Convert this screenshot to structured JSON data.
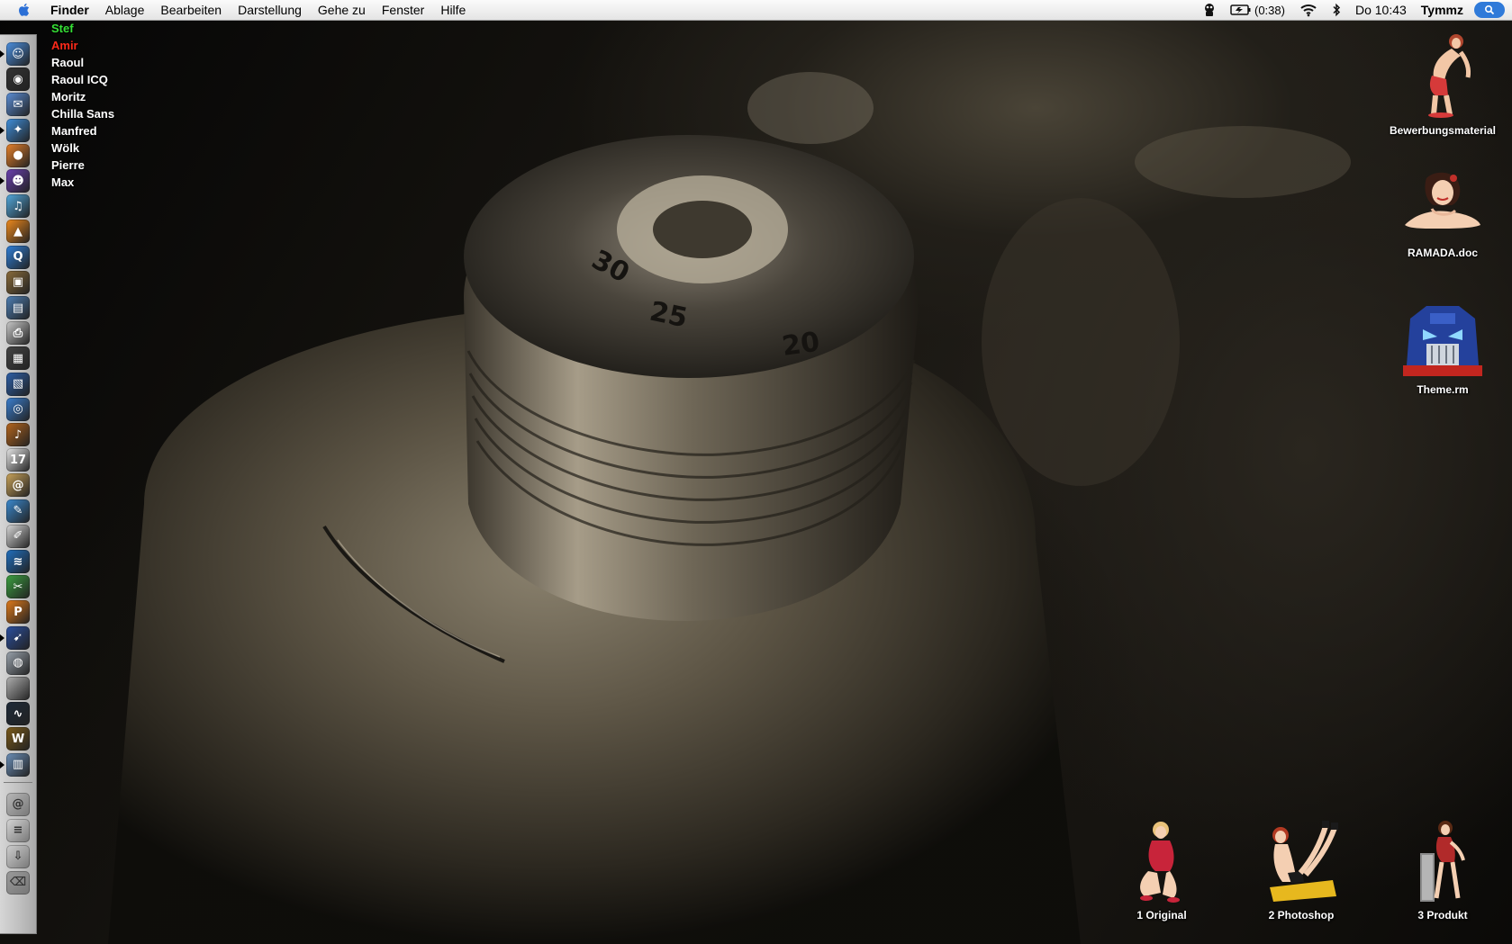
{
  "menubar": {
    "app_name": "Finder",
    "menus": [
      "Ablage",
      "Bearbeiten",
      "Darstellung",
      "Gehe zu",
      "Fenster",
      "Hilfe"
    ],
    "battery": "(0:38)",
    "clock": "Do 10:43",
    "user": "Tymmz",
    "icons": [
      "apple-icon",
      "status-app-icon",
      "battery-icon",
      "wifi-icon",
      "bluetooth-icon",
      "spotlight-icon"
    ]
  },
  "buddies": [
    {
      "name": "Stef",
      "color": "#35e035"
    },
    {
      "name": "Amir",
      "color": "#ff2a1a"
    },
    {
      "name": "Raoul",
      "color": "#ffffff"
    },
    {
      "name": "Raoul ICQ",
      "color": "#ffffff"
    },
    {
      "name": "Moritz",
      "color": "#ffffff"
    },
    {
      "name": "Chilla Sans",
      "color": "#ffffff"
    },
    {
      "name": "Manfred",
      "color": "#ffffff"
    },
    {
      "name": "Wölk",
      "color": "#ffffff"
    },
    {
      "name": "Pierre",
      "color": "#ffffff"
    },
    {
      "name": "Max",
      "color": "#ffffff"
    }
  ],
  "desktop_icons": {
    "bewerbungsmaterial": "Bewerbungsmaterial",
    "ramada": "RAMADA.doc",
    "theme": "Theme.rm",
    "original": "1 Original",
    "photoshop": "2 Photoshop",
    "produkt": "3 Produkt"
  },
  "dock": {
    "apps": [
      {
        "name": "finder-icon",
        "color": "#4a8fe0",
        "glyph": "☺",
        "running": true
      },
      {
        "name": "dashboard-icon",
        "color": "#333333",
        "glyph": "◉",
        "running": false
      },
      {
        "name": "mail-icon",
        "color": "#5b8ed6",
        "glyph": "✉",
        "running": false
      },
      {
        "name": "safari-icon",
        "color": "#3f8fdc",
        "glyph": "✦",
        "running": true
      },
      {
        "name": "firefox-icon",
        "color": "#e8812a",
        "glyph": "●",
        "running": false
      },
      {
        "name": "adium-icon",
        "color": "#6a3fb0",
        "glyph": "☻",
        "running": true
      },
      {
        "name": "itunes-icon",
        "color": "#52a9de",
        "glyph": "♫",
        "running": false
      },
      {
        "name": "vlc-icon",
        "color": "#f08a1c",
        "glyph": "▲",
        "running": false
      },
      {
        "name": "quicktime-icon",
        "color": "#2f7fd8",
        "glyph": "Q",
        "running": false
      },
      {
        "name": "iphoto-icon",
        "color": "#8a6b3a",
        "glyph": "▣",
        "running": false
      },
      {
        "name": "preview-icon",
        "color": "#4d7eb3",
        "glyph": "▤",
        "running": false
      },
      {
        "name": "printer-icon",
        "color": "#c9c9c9",
        "glyph": "⎙",
        "running": false
      },
      {
        "name": "imovie-icon",
        "color": "#444444",
        "glyph": "▦",
        "running": false
      },
      {
        "name": "finalcut-icon",
        "color": "#2d5fa8",
        "glyph": "▧",
        "running": false
      },
      {
        "name": "dvd-player-icon",
        "color": "#3a7fd0",
        "glyph": "◎",
        "running": false
      },
      {
        "name": "garageband-icon",
        "color": "#b5651d",
        "glyph": "♪",
        "running": false
      },
      {
        "name": "ical-icon",
        "color": "#e8e8e8",
        "glyph": "17",
        "running": false
      },
      {
        "name": "address-book-icon",
        "color": "#c9a35a",
        "glyph": "@",
        "running": false
      },
      {
        "name": "textedit-icon",
        "color": "#3a8ad0",
        "glyph": "✎",
        "running": false
      },
      {
        "name": "pages-icon",
        "color": "#d8d8d8",
        "glyph": "✐",
        "running": false
      },
      {
        "name": "dreamweaver-icon",
        "color": "#1f6fbf",
        "glyph": "≋",
        "running": false
      },
      {
        "name": "cyberduck-icon",
        "color": "#3ba040",
        "glyph": "✂",
        "running": false
      },
      {
        "name": "illustrator-icon",
        "color": "#e07a1a",
        "glyph": "P",
        "running": false
      },
      {
        "name": "transmission-icon",
        "color": "#2b4fa0",
        "glyph": "➹",
        "running": true
      },
      {
        "name": "disk-utility-icon",
        "color": "#9aa3ad",
        "glyph": "◍",
        "running": false
      },
      {
        "name": "system-profiler-icon",
        "color": "#b0b0b0",
        "glyph": "",
        "running": false
      },
      {
        "name": "activity-monitor-icon",
        "color": "#1e2a38",
        "glyph": "∿",
        "running": false
      },
      {
        "name": "warcraft-icon",
        "color": "#7a5a1a",
        "glyph": "W",
        "running": false
      },
      {
        "name": "remote-desktop-icon",
        "color": "#6b8fb8",
        "glyph": "▥",
        "running": true
      }
    ],
    "docs": [
      {
        "name": "network-folder-icon",
        "color": "#b8b8b8",
        "glyph": "@"
      },
      {
        "name": "documents-stack-icon",
        "color": "#d6d6d6",
        "glyph": "≡"
      },
      {
        "name": "downloads-stack-icon",
        "color": "#cfcfcf",
        "glyph": "⇩"
      },
      {
        "name": "trash-icon",
        "color": "#9a9a9a",
        "glyph": "⌫"
      }
    ]
  }
}
